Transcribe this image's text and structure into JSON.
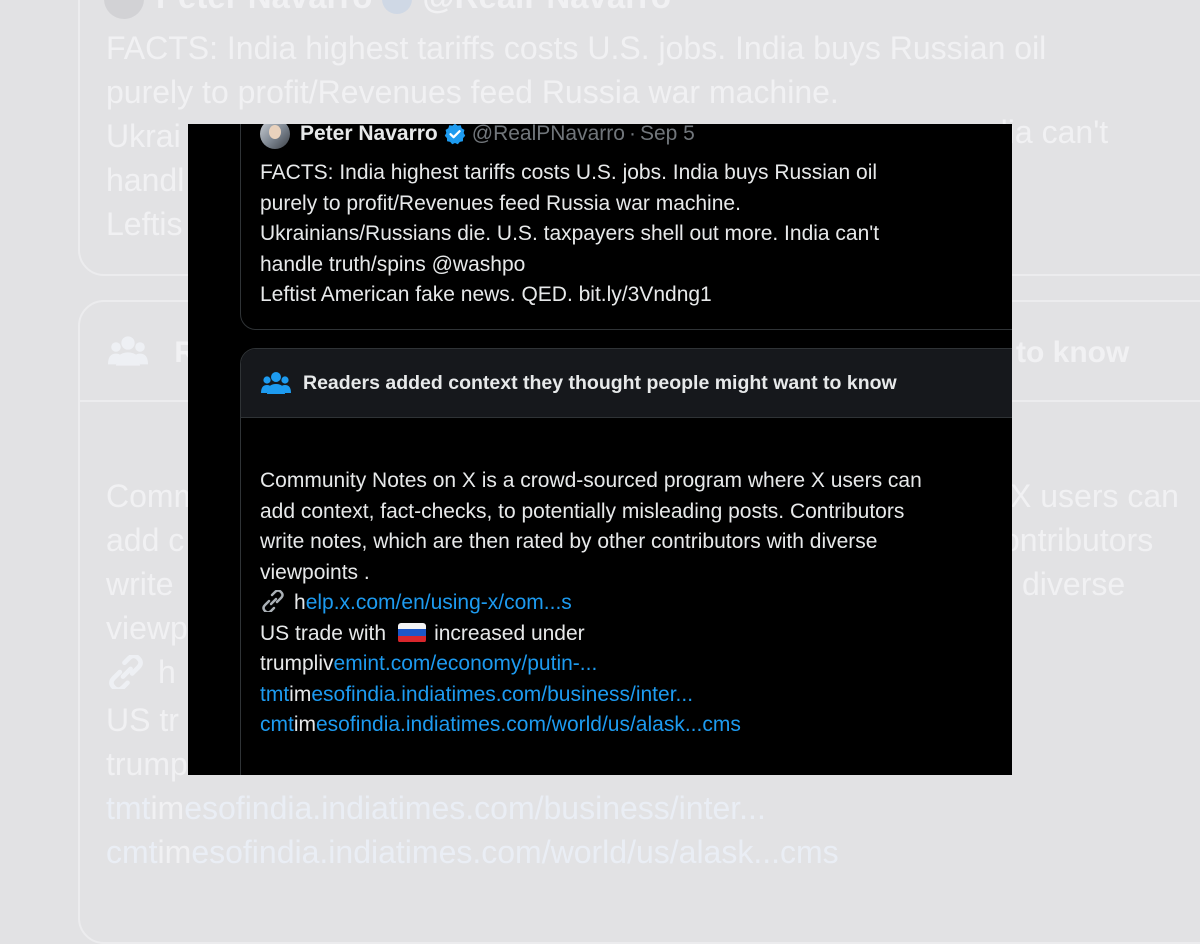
{
  "tweet": {
    "author_name": "Peter Navarro",
    "handle": "@RealPNavarro",
    "separator": "·",
    "date": "Sep 5",
    "text": "FACTS: India highest tariffs costs U.S. jobs.  India buys Russian oil\npurely to profit/Revenues feed Russia war machine.\nUkrainians/Russians die.  U.S. taxpayers shell out more.  India can't\nhandle truth/spins @washpo\nLeftist American fake news.  QED. bit.ly/3Vndng1"
  },
  "community_note": {
    "header": "Readers added context they thought people might want to know",
    "body": "Community Notes on X is a crowd-sourced program where X users can\nadd context, fact-checks, to potentially misleading posts. Contributors\nwrite notes, which are then rated by other contributors with diverse\nviewpoints .",
    "link1_prefix": "h",
    "link1_text": "elp.x.com/en/using-x/com...s",
    "trade_text_before": "US trade with",
    "trade_text_after": "increased under",
    "line3_prefix": "trumpliv",
    "line3_link": "emint.com/economy/putin-...",
    "line4_prefix_a": "tmt",
    "line4_prefix_b": "im",
    "line4_link": "esofindia.indiatimes.com/business/inter...",
    "line5_prefix_a": "cmt",
    "line5_prefix_b": "im",
    "line5_link": "esofindia.indiatimes.com/world/us/alask...cms"
  },
  "background": {
    "tweet_text": "FACTS: India highest tariffs costs U.S. jobs.  India buys Russian oil\npurely to profit/Revenues feed Russia war machine.\nUkrai\nhandl\nLeftis",
    "tweet_right_fragment": "dia can't",
    "note_header_start": "R",
    "note_header_end": "to know",
    "note_text": "Comm\nadd c\nwrite\nviewp",
    "note_right_1": "X users can",
    "note_right_2": "ontributors",
    "note_right_3": "diverse",
    "bg_link1_prefix": "h",
    "bg_trade": "US tr",
    "bg_trump": "trump",
    "bg_line4_prefix_a": "tmt",
    "bg_line4_prefix_b": "im",
    "bg_line4_link": "esofindia.indiatimes.com/business/inter...",
    "bg_line5_prefix_a": "cmt",
    "bg_line5_prefix_b": "im",
    "bg_line5_link": "esofindia.indiatimes.com/world/us/alask...cms"
  },
  "icons": {
    "verified": "verified-badge-icon",
    "people": "people-icon",
    "link": "link-icon",
    "flag": "russia-flag-icon"
  },
  "colors": {
    "page_background": "#e2e2e4",
    "card_background": "#000000",
    "text_primary": "#e7e9ea",
    "text_secondary": "#71767b",
    "link": "#1d9bf0",
    "note_header_background": "#16181c",
    "border": "#2f3336"
  }
}
